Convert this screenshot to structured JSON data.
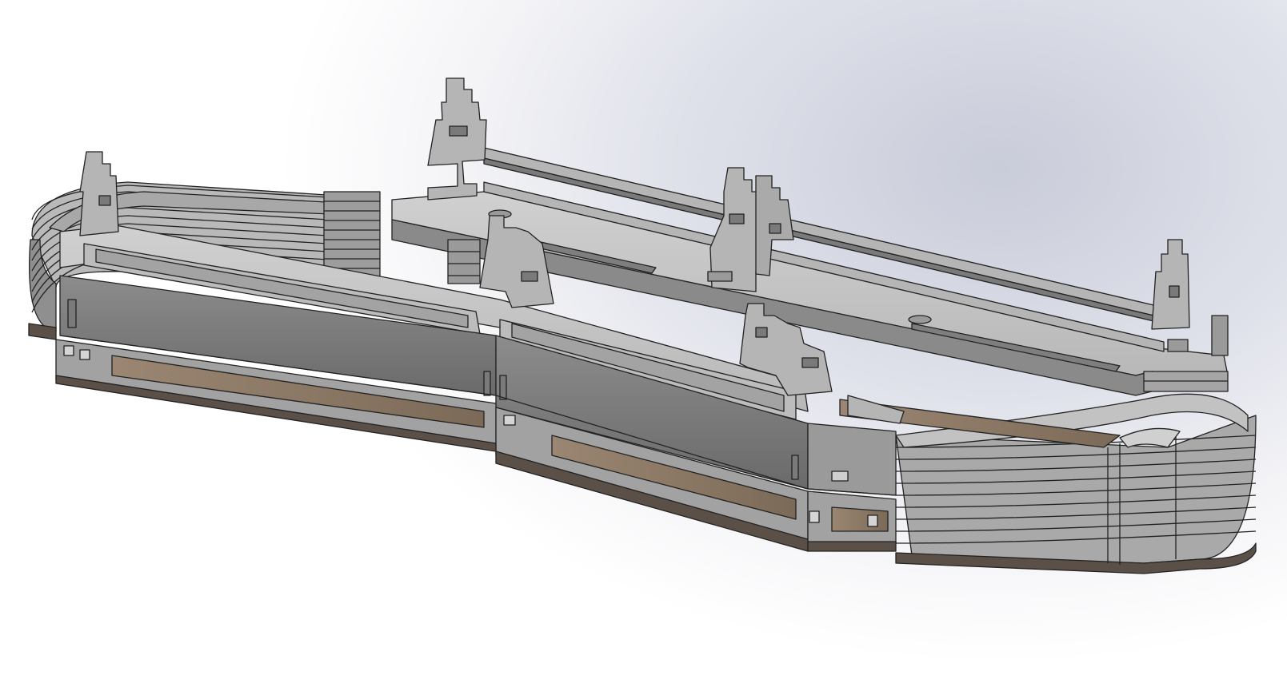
{
  "viewport": {
    "background_top": "#c9ccd9",
    "background_bottom": "#ffffff"
  },
  "model": {
    "description_icon": "cad-3d-model-icon",
    "colors": {
      "body": "#9a9a9a",
      "face_light": "#bdbdbd",
      "face_top": "#c9c9c9",
      "face_dark": "#6f6f6f",
      "edge": "#222222",
      "wood": "#8a7a68",
      "base": "#5a5048"
    }
  }
}
